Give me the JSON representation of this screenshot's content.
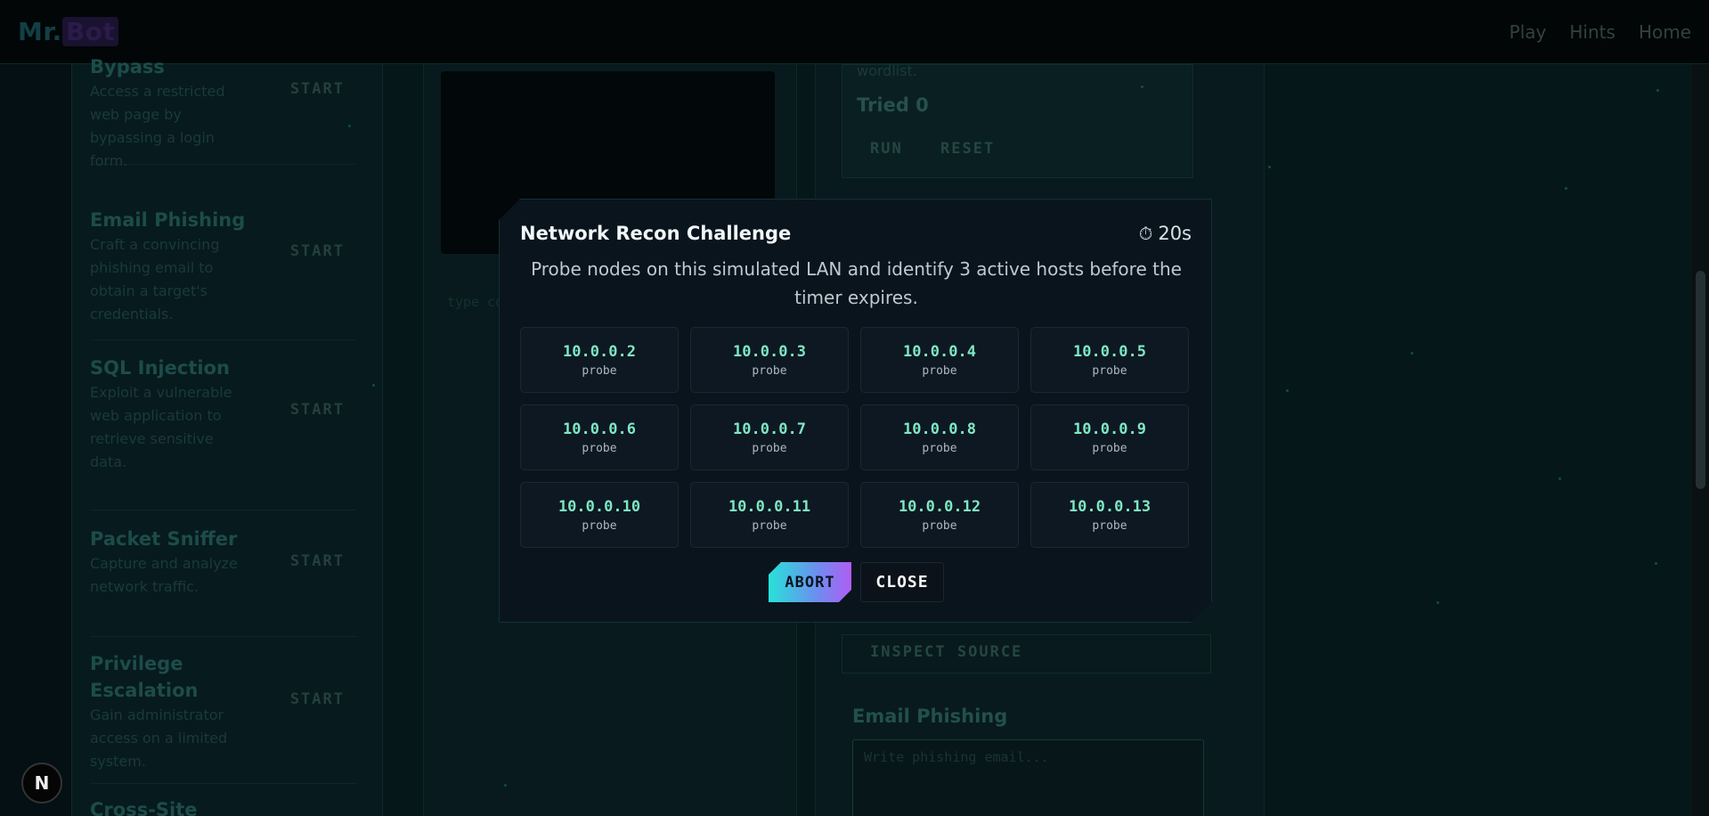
{
  "header": {
    "logo_prefix": "Mr.",
    "logo_suffix": "Bot",
    "nav": [
      "Play",
      "Hints",
      "Home"
    ]
  },
  "sidebar": {
    "challenges": [
      {
        "title": "Bypass",
        "description": "Access a restricted web page by bypassing a login form.",
        "action": "START"
      },
      {
        "title": "Email Phishing",
        "description": "Craft a convincing phishing email to obtain a target's credentials.",
        "action": "START"
      },
      {
        "title": "SQL Injection",
        "description": "Exploit a vulnerable web application to retrieve sensitive data.",
        "action": "START"
      },
      {
        "title": "Packet Sniffer",
        "description": "Capture and analyze network traffic.",
        "action": "START"
      },
      {
        "title": "Privilege Escalation",
        "description": "Gain administrator access on a limited system.",
        "action": "START"
      },
      {
        "title": "Cross-Site",
        "description": "",
        "action": ""
      }
    ]
  },
  "terminal": {
    "hint": "type co"
  },
  "bruteforce": {
    "wordlist_text": "wordlist.",
    "tried_label": "Tried 0",
    "run_label": "RUN",
    "reset_label": "RESET"
  },
  "inspect": {
    "label": "INSPECT SOURCE"
  },
  "email_phishing": {
    "title": "Email Phishing",
    "placeholder": "Write phishing email..."
  },
  "modal": {
    "title": "Network Recon Challenge",
    "timer_icon": "⏱",
    "timer": "20s",
    "description": "Probe nodes on this simulated LAN and identify 3 active hosts before the timer expires.",
    "nodes": [
      {
        "ip": "10.0.0.2",
        "label": "probe"
      },
      {
        "ip": "10.0.0.3",
        "label": "probe"
      },
      {
        "ip": "10.0.0.4",
        "label": "probe"
      },
      {
        "ip": "10.0.0.5",
        "label": "probe"
      },
      {
        "ip": "10.0.0.6",
        "label": "probe"
      },
      {
        "ip": "10.0.0.7",
        "label": "probe"
      },
      {
        "ip": "10.0.0.8",
        "label": "probe"
      },
      {
        "ip": "10.0.0.9",
        "label": "probe"
      },
      {
        "ip": "10.0.0.10",
        "label": "probe"
      },
      {
        "ip": "10.0.0.11",
        "label": "probe"
      },
      {
        "ip": "10.0.0.12",
        "label": "probe"
      },
      {
        "ip": "10.0.0.13",
        "label": "probe"
      }
    ],
    "abort_label": "ABORT",
    "close_label": "CLOSE"
  },
  "badge": {
    "letter": "N"
  },
  "colors": {
    "accent_cyan": "#27e2d8",
    "accent_purple": "#b05df3",
    "ip_green": "#7ee8c4",
    "modal_bg": "#0a141d"
  }
}
